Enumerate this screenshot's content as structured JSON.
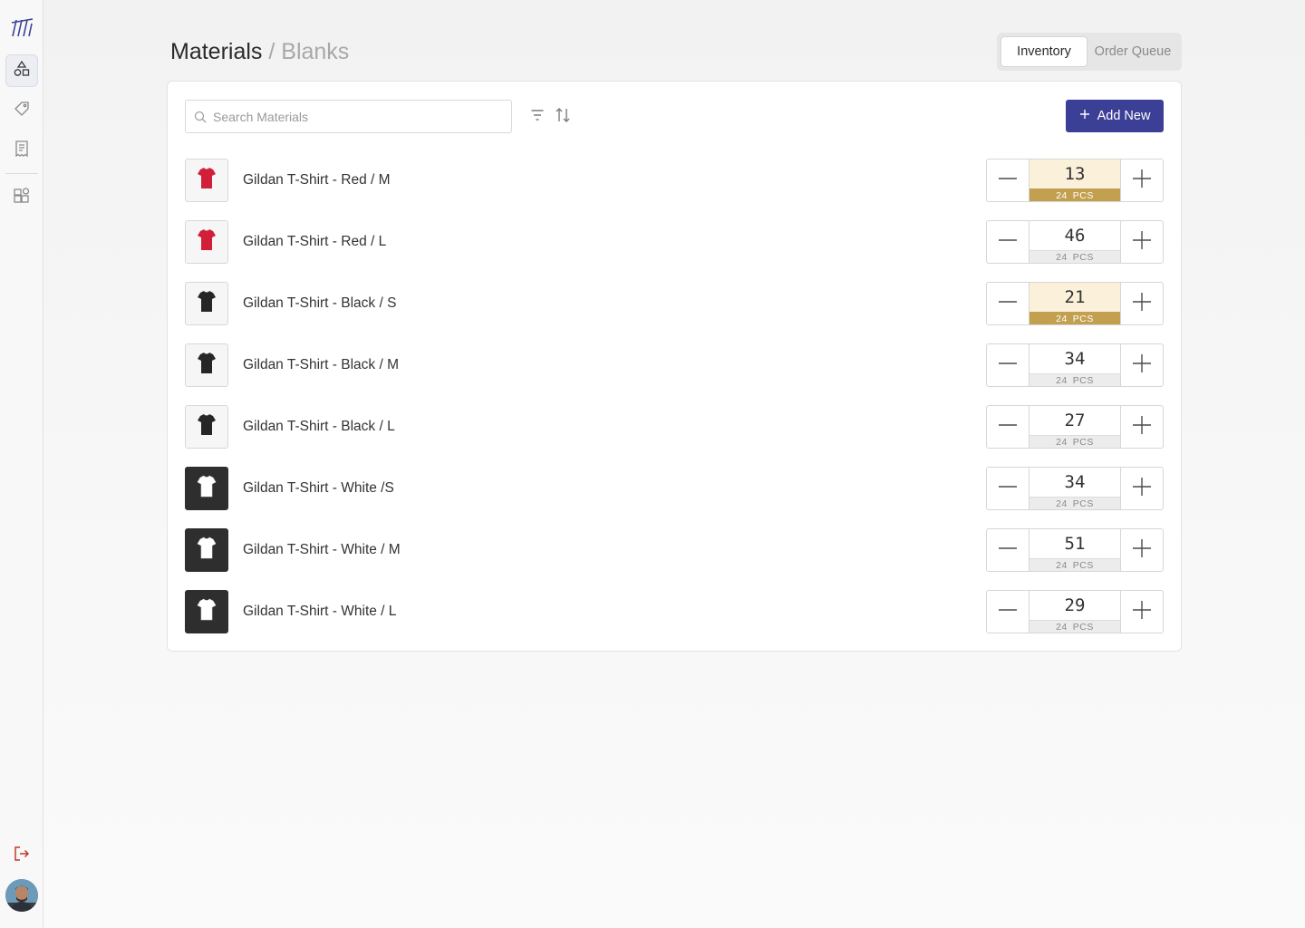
{
  "sidebar": {
    "items": [
      {
        "name": "materials",
        "icon": "shapes-icon",
        "active": true
      },
      {
        "name": "tags",
        "icon": "tag-icon",
        "active": false
      },
      {
        "name": "orders",
        "icon": "receipt-icon",
        "active": false
      },
      {
        "name": "apps",
        "icon": "add-widget-icon",
        "active": false
      }
    ],
    "logout_icon": "logout-icon"
  },
  "header": {
    "title": "Materials",
    "separator": " / ",
    "subtitle": "Blanks"
  },
  "tabs": [
    {
      "label": "Inventory",
      "active": true
    },
    {
      "label": "Order Queue",
      "active": false
    }
  ],
  "toolbar": {
    "search_placeholder": "Search Materials",
    "add_label": "Add New"
  },
  "colors": {
    "accent": "#3b3f96",
    "low_stock": "#c3a050",
    "low_stock_bg": "#fbf0da",
    "logout": "#c0392b"
  },
  "items": [
    {
      "name": "Gildan T-Shirt - Red / M",
      "shirt_color": "#d11f3a",
      "qty": "13",
      "pack": "24",
      "unit": "PCS",
      "low": true
    },
    {
      "name": "Gildan T-Shirt - Red / L",
      "shirt_color": "#d11f3a",
      "qty": "46",
      "pack": "24",
      "unit": "PCS",
      "low": false
    },
    {
      "name": "Gildan T-Shirt - Black / S",
      "shirt_color": "#262626",
      "qty": "21",
      "pack": "24",
      "unit": "PCS",
      "low": true
    },
    {
      "name": "Gildan T-Shirt - Black / M",
      "shirt_color": "#262626",
      "qty": "34",
      "pack": "24",
      "unit": "PCS",
      "low": false
    },
    {
      "name": "Gildan T-Shirt - Black / L",
      "shirt_color": "#262626",
      "qty": "27",
      "pack": "24",
      "unit": "PCS",
      "low": false
    },
    {
      "name": "Gildan T-Shirt - White /S",
      "shirt_color": "#ffffff",
      "qty": "34",
      "pack": "24",
      "unit": "PCS",
      "low": false
    },
    {
      "name": "Gildan T-Shirt - White / M",
      "shirt_color": "#ffffff",
      "qty": "51",
      "pack": "24",
      "unit": "PCS",
      "low": false
    },
    {
      "name": "Gildan T-Shirt - White / L",
      "shirt_color": "#ffffff",
      "qty": "29",
      "pack": "24",
      "unit": "PCS",
      "low": false
    }
  ]
}
